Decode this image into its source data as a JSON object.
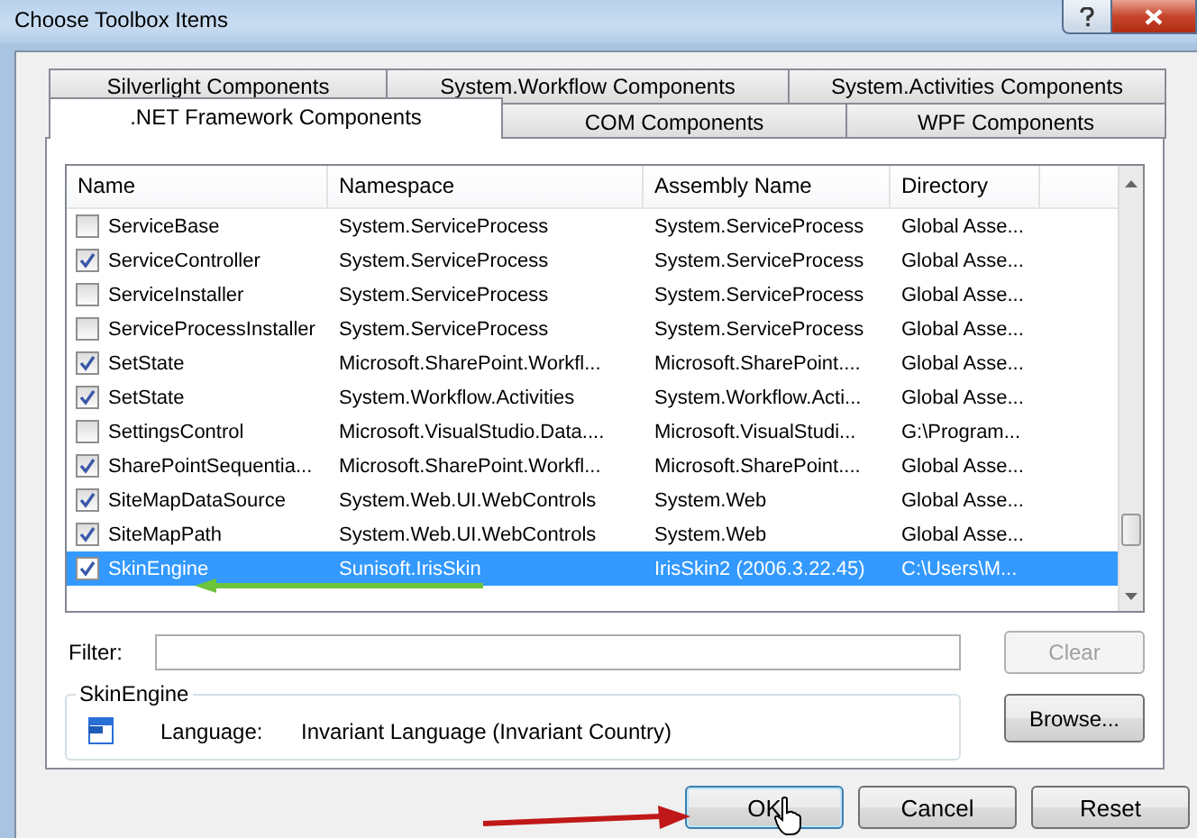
{
  "window": {
    "title": "Choose Toolbox Items"
  },
  "tab_rows": [
    [
      {
        "label": "Silverlight Components",
        "selected": false
      },
      {
        "label": "System.Workflow Components",
        "selected": false
      },
      {
        "label": "System.Activities Components",
        "selected": false
      }
    ],
    [
      {
        "label": ".NET Framework Components",
        "selected": true
      },
      {
        "label": "COM Components",
        "selected": false
      },
      {
        "label": "WPF Components",
        "selected": false
      }
    ]
  ],
  "table": {
    "columns": [
      "Name",
      "Namespace",
      "Assembly Name",
      "Directory"
    ],
    "rows": [
      {
        "checked": false,
        "selected": false,
        "cells": [
          "ServiceBase",
          "System.ServiceProcess",
          "System.ServiceProcess",
          "Global Asse..."
        ]
      },
      {
        "checked": true,
        "selected": false,
        "cells": [
          "ServiceController",
          "System.ServiceProcess",
          "System.ServiceProcess",
          "Global Asse..."
        ]
      },
      {
        "checked": false,
        "selected": false,
        "cells": [
          "ServiceInstaller",
          "System.ServiceProcess",
          "System.ServiceProcess",
          "Global Asse..."
        ]
      },
      {
        "checked": false,
        "selected": false,
        "cells": [
          "ServiceProcessInstaller",
          "System.ServiceProcess",
          "System.ServiceProcess",
          "Global Asse..."
        ]
      },
      {
        "checked": true,
        "selected": false,
        "cells": [
          "SetState",
          "Microsoft.SharePoint.Workfl...",
          "Microsoft.SharePoint....",
          "Global Asse..."
        ]
      },
      {
        "checked": true,
        "selected": false,
        "cells": [
          "SetState",
          "System.Workflow.Activities",
          "System.Workflow.Acti...",
          "Global Asse..."
        ]
      },
      {
        "checked": false,
        "selected": false,
        "cells": [
          "SettingsControl",
          "Microsoft.VisualStudio.Data....",
          "Microsoft.VisualStudi...",
          "G:\\Program..."
        ]
      },
      {
        "checked": true,
        "selected": false,
        "cells": [
          "SharePointSequentia...",
          "Microsoft.SharePoint.Workfl...",
          "Microsoft.SharePoint....",
          "Global Asse..."
        ]
      },
      {
        "checked": true,
        "selected": false,
        "cells": [
          "SiteMapDataSource",
          "System.Web.UI.WebControls",
          "System.Web",
          "Global Asse..."
        ]
      },
      {
        "checked": true,
        "selected": false,
        "cells": [
          "SiteMapPath",
          "System.Web.UI.WebControls",
          "System.Web",
          "Global Asse..."
        ]
      },
      {
        "checked": true,
        "selected": true,
        "cells": [
          "SkinEngine",
          "Sunisoft.IrisSkin",
          "IrisSkin2 (2006.3.22.45)",
          "C:\\Users\\M..."
        ]
      }
    ]
  },
  "filter": {
    "label": "Filter:"
  },
  "clear_button": {
    "label": "Clear",
    "disabled": true
  },
  "details": {
    "title": "SkinEngine",
    "label": "Language:",
    "value": "Invariant Language (Invariant Country)"
  },
  "browse_button": {
    "label": "Browse..."
  },
  "buttons": [
    "OK",
    "Cancel",
    "Reset"
  ]
}
